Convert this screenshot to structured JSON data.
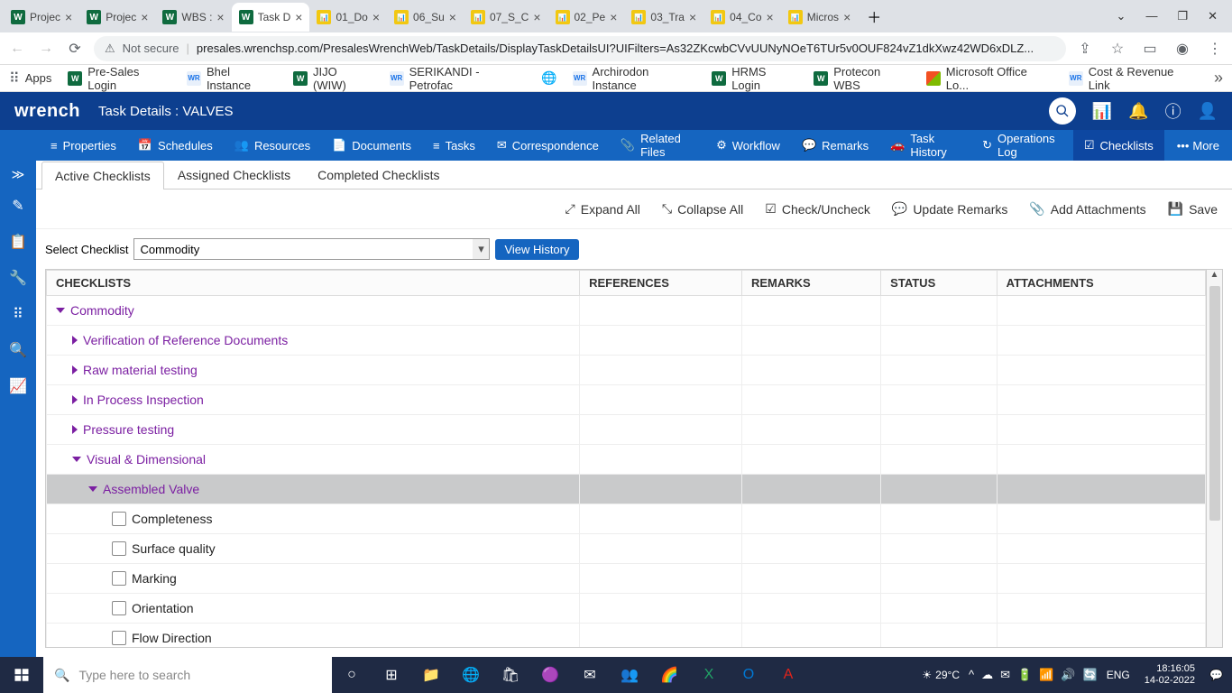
{
  "browser": {
    "tabs": [
      {
        "icon": "w",
        "title": "Projec"
      },
      {
        "icon": "w",
        "title": "Projec"
      },
      {
        "icon": "w",
        "title": "WBS :"
      },
      {
        "icon": "w",
        "title": "Task D",
        "active": true
      },
      {
        "icon": "pbi",
        "title": "01_Do"
      },
      {
        "icon": "pbi",
        "title": "06_Su"
      },
      {
        "icon": "pbi",
        "title": "07_S_C"
      },
      {
        "icon": "pbi",
        "title": "02_Pe"
      },
      {
        "icon": "pbi",
        "title": "03_Tra"
      },
      {
        "icon": "pbi",
        "title": "04_Co"
      },
      {
        "icon": "pbi",
        "title": "Micros"
      }
    ],
    "security_label": "Not secure",
    "url": "presales.wrenchsp.com/PresalesWrenchWeb/TaskDetails/DisplayTaskDetailsUI?UIFilters=As32ZKcwbCVvUUNyNOeT6TUr5v0OUF824vZ1dkXwz42WD6xDLZ...",
    "bookmarks_label": "Apps",
    "bookmarks": [
      {
        "icon": "w",
        "label": "Pre-Sales Login"
      },
      {
        "icon": "wr",
        "label": "Bhel Instance"
      },
      {
        "icon": "w",
        "label": "JIJO (WIW)"
      },
      {
        "icon": "wr",
        "label": "SERIKANDI - Petrofac"
      },
      {
        "icon": "globe",
        "label": ""
      },
      {
        "icon": "wr",
        "label": "Archirodon Instance"
      },
      {
        "icon": "w",
        "label": "HRMS Login"
      },
      {
        "icon": "w",
        "label": "Protecon WBS"
      },
      {
        "icon": "ms",
        "label": "Microsoft Office Lo..."
      },
      {
        "icon": "wr",
        "label": "Cost & Revenue Link"
      }
    ]
  },
  "app": {
    "logo": "wrench",
    "task_title": "Task Details : VALVES",
    "menu": [
      "Properties",
      "Schedules",
      "Resources",
      "Documents",
      "Tasks",
      "Correspondence",
      "Related Files",
      "Workflow",
      "Remarks",
      "Task History",
      "Operations Log",
      "Checklists"
    ],
    "menu_active": "Checklists",
    "menu_more": "More"
  },
  "subtabs": {
    "items": [
      "Active Checklists",
      "Assigned Checklists",
      "Completed Checklists"
    ],
    "active": "Active Checklists"
  },
  "toolbar": {
    "expand_all": "Expand All",
    "collapse_all": "Collapse All",
    "check_uncheck": "Check/Uncheck",
    "update_remarks": "Update Remarks",
    "add_attachments": "Add Attachments",
    "save": "Save"
  },
  "selector": {
    "label": "Select Checklist",
    "value": "Commodity",
    "button": "View History"
  },
  "grid": {
    "headers": [
      "CHECKLISTS",
      "REFERENCES",
      "REMARKS",
      "STATUS",
      "ATTACHMENTS"
    ],
    "rows": [
      {
        "type": "group",
        "level": 0,
        "expanded": true,
        "text": "Commodity"
      },
      {
        "type": "group",
        "level": 1,
        "expanded": false,
        "text": "Verification of Reference Documents"
      },
      {
        "type": "group",
        "level": 1,
        "expanded": false,
        "text": "Raw material testing"
      },
      {
        "type": "group",
        "level": 1,
        "expanded": false,
        "text": "In Process Inspection"
      },
      {
        "type": "group",
        "level": 1,
        "expanded": false,
        "text": "Pressure testing"
      },
      {
        "type": "group",
        "level": 1,
        "expanded": true,
        "text": "Visual & Dimensional"
      },
      {
        "type": "group",
        "level": 2,
        "expanded": true,
        "text": "Assembled Valve",
        "selected": true
      },
      {
        "type": "item",
        "level": 3,
        "text": "Completeness"
      },
      {
        "type": "item",
        "level": 3,
        "text": "Surface quality"
      },
      {
        "type": "item",
        "level": 3,
        "text": "Marking"
      },
      {
        "type": "item",
        "level": 3,
        "text": "Orientation"
      },
      {
        "type": "item",
        "level": 3,
        "text": "Flow Direction"
      }
    ]
  },
  "taskbar": {
    "search_placeholder": "Type here to search",
    "weather": "29°C",
    "lang": "ENG",
    "time": "18:16:05",
    "date": "14-02-2022"
  }
}
